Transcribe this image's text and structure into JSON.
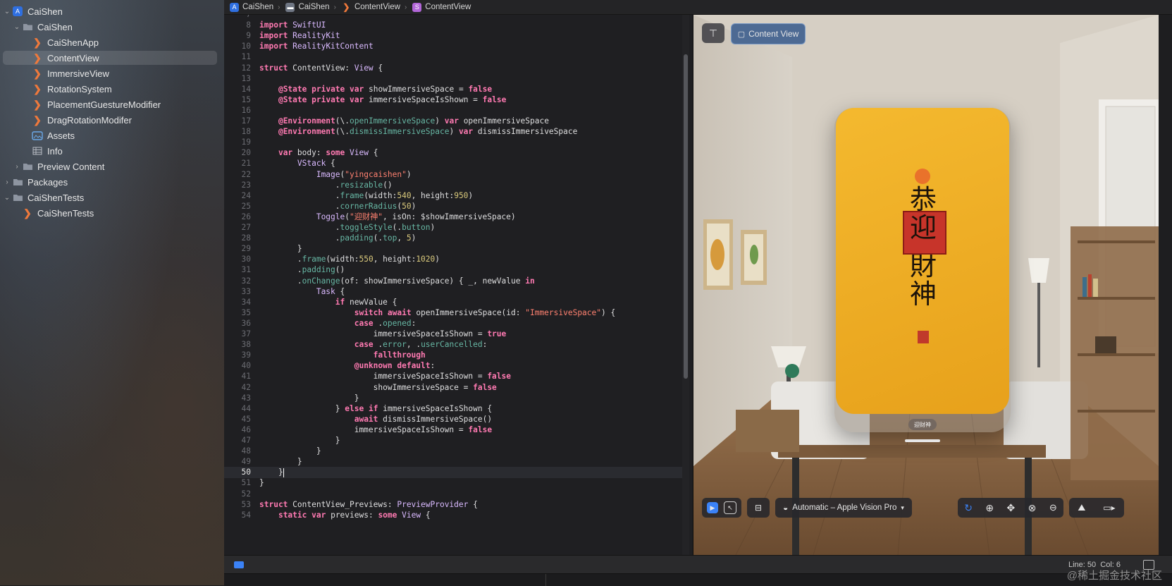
{
  "sidebar": {
    "items": [
      {
        "label": "CaiShen",
        "icon": "app-project-icon",
        "chevron": "down"
      },
      {
        "label": "CaiShen",
        "icon": "folder-icon",
        "chevron": "down"
      },
      {
        "label": "CaiShenApp",
        "icon": "swift-file-icon"
      },
      {
        "label": "ContentView",
        "icon": "swift-file-icon"
      },
      {
        "label": "ImmersiveView",
        "icon": "swift-file-icon"
      },
      {
        "label": "RotationSystem",
        "icon": "swift-file-icon"
      },
      {
        "label": "PlacementGuestureModifier",
        "icon": "swift-file-icon"
      },
      {
        "label": "DragRotationModifer",
        "icon": "swift-file-icon"
      },
      {
        "label": "Assets",
        "icon": "assets-catalog-icon"
      },
      {
        "label": "Info",
        "icon": "plist-table-icon"
      },
      {
        "label": "Preview Content",
        "icon": "folder-icon",
        "chevron": "right"
      },
      {
        "label": "Packages",
        "icon": "folder-icon",
        "chevron": "right"
      },
      {
        "label": "CaiShenTests",
        "icon": "folder-icon",
        "chevron": "down"
      },
      {
        "label": "CaiShenTests",
        "icon": "swift-file-icon"
      }
    ]
  },
  "breadcrumb": [
    "CaiShen",
    "CaiShen",
    "ContentView",
    "ContentView"
  ],
  "editor": {
    "current_line": 50,
    "lines": [
      {
        "n": "7",
        "t": ""
      },
      {
        "n": "8",
        "t": "import SwiftUI"
      },
      {
        "n": "9",
        "t": "import RealityKit"
      },
      {
        "n": "10",
        "t": "import RealityKitContent"
      },
      {
        "n": "11",
        "t": ""
      },
      {
        "n": "12",
        "t": "struct ContentView: View {"
      },
      {
        "n": "13",
        "t": ""
      },
      {
        "n": "14",
        "t": "    @State private var showImmersiveSpace = false"
      },
      {
        "n": "15",
        "t": "    @State private var immersiveSpaceIsShown = false"
      },
      {
        "n": "16",
        "t": ""
      },
      {
        "n": "17",
        "t": "    @Environment(\\.openImmersiveSpace) var openImmersiveSpace"
      },
      {
        "n": "18",
        "t": "    @Environment(\\.dismissImmersiveSpace) var dismissImmersiveSpace"
      },
      {
        "n": "19",
        "t": ""
      },
      {
        "n": "20",
        "t": "    var body: some View {"
      },
      {
        "n": "21",
        "t": "        VStack {"
      },
      {
        "n": "22",
        "t": "            Image(\"yingcaishen\")"
      },
      {
        "n": "23",
        "t": "                .resizable()"
      },
      {
        "n": "24",
        "t": "                .frame(width:540, height:950)"
      },
      {
        "n": "25",
        "t": "                .cornerRadius(50)"
      },
      {
        "n": "26",
        "t": "            Toggle(\"迎财神\", isOn: $showImmersiveSpace)"
      },
      {
        "n": "27",
        "t": "                .toggleStyle(.button)"
      },
      {
        "n": "28",
        "t": "                .padding(.top, 5)"
      },
      {
        "n": "29",
        "t": "        }"
      },
      {
        "n": "30",
        "t": "        .frame(width:550, height:1020)"
      },
      {
        "n": "31",
        "t": "        .padding()"
      },
      {
        "n": "32",
        "t": "        .onChange(of: showImmersiveSpace) { _, newValue in"
      },
      {
        "n": "33",
        "t": "            Task {"
      },
      {
        "n": "34",
        "t": "                if newValue {"
      },
      {
        "n": "35",
        "t": "                    switch await openImmersiveSpace(id: \"ImmersiveSpace\") {"
      },
      {
        "n": "36",
        "t": "                    case .opened:"
      },
      {
        "n": "37",
        "t": "                        immersiveSpaceIsShown = true"
      },
      {
        "n": "38",
        "t": "                    case .error, .userCancelled:"
      },
      {
        "n": "39",
        "t": "                        fallthrough"
      },
      {
        "n": "40",
        "t": "                    @unknown default:"
      },
      {
        "n": "41",
        "t": "                        immersiveSpaceIsShown = false"
      },
      {
        "n": "42",
        "t": "                        showImmersiveSpace = false"
      },
      {
        "n": "43",
        "t": "                    }"
      },
      {
        "n": "44",
        "t": "                } else if immersiveSpaceIsShown {"
      },
      {
        "n": "45",
        "t": "                    await dismissImmersiveSpace()"
      },
      {
        "n": "46",
        "t": "                    immersiveSpaceIsShown = false"
      },
      {
        "n": "47",
        "t": "                }"
      },
      {
        "n": "48",
        "t": "            }"
      },
      {
        "n": "49",
        "t": "        }"
      },
      {
        "n": "50",
        "t": "    }"
      },
      {
        "n": "51",
        "t": "}"
      },
      {
        "n": "52",
        "t": ""
      },
      {
        "n": "53",
        "t": "struct ContentView_Previews: PreviewProvider {"
      },
      {
        "n": "54",
        "t": "    static var previews: some View {"
      }
    ]
  },
  "preview": {
    "pin_icon": "pin-icon",
    "tab_label": "Content View",
    "card_calligraphy": [
      "恭",
      "迎",
      "財",
      "神"
    ],
    "toggle_label": "迎财神",
    "device_label": "Automatic – Apple Vision Pro"
  },
  "status": {
    "cursor": "Line: 50  Col: 6"
  },
  "watermark": "@稀土掘金技术社区",
  "colors": {
    "keyword": "#ff7ab2",
    "type": "#dabaff",
    "function": "#67b7a4",
    "string": "#ff8170",
    "number": "#d9c97c",
    "swift_icon": "#f0793b",
    "accent": "#3b82f6",
    "card": "#efb020"
  }
}
